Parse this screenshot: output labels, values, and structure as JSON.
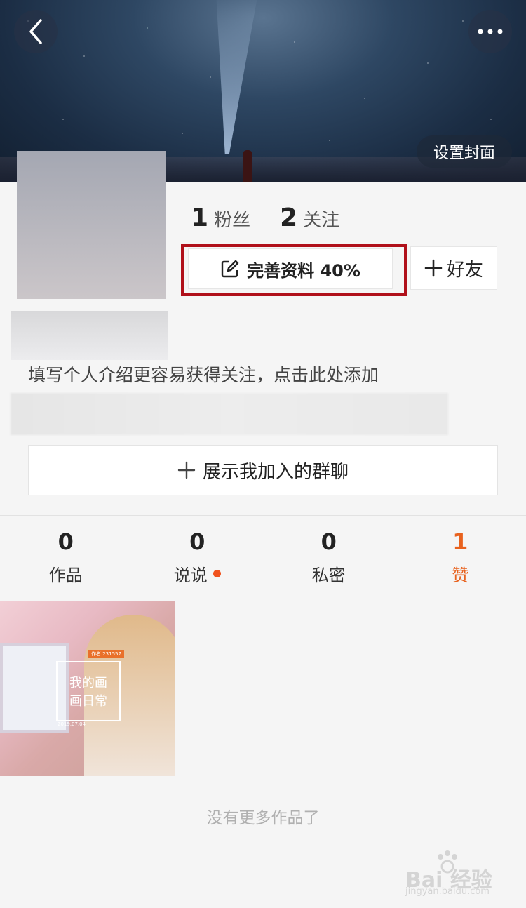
{
  "header": {
    "cover_button_label": "设置封面",
    "back_icon": "chevron-left-icon",
    "more_icon": "ellipsis-icon"
  },
  "profile": {
    "fans_count": "1",
    "fans_label": "粉丝",
    "following_count": "2",
    "following_label": "关注",
    "edit_profile_label": "完善资料 40%",
    "add_friend_label": "好友",
    "bio_placeholder": "填写个人介绍更容易获得关注，点击此处添加",
    "show_groups_label": "展示我加入的群聊"
  },
  "tabs": [
    {
      "count": "0",
      "label": "作品"
    },
    {
      "count": "0",
      "label": "说说"
    },
    {
      "count": "0",
      "label": "私密"
    },
    {
      "count": "1",
      "label": "赞"
    }
  ],
  "works": [
    {
      "title_line1": "我的画",
      "title_line2": "画日常",
      "tag": "作者 231557",
      "date": "2019.07.04"
    }
  ],
  "footer": {
    "no_more_label": "没有更多作品了",
    "watermark_text": "Bai 经验",
    "watermark_url": "jingyan.baidu.com"
  },
  "colors": {
    "accent": "#e8621e",
    "highlight_box": "#b0101a"
  }
}
